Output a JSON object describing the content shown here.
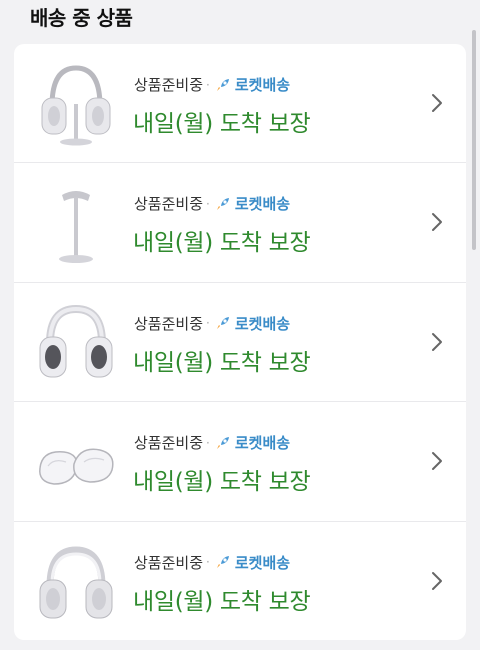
{
  "section": {
    "title": "배송 중 상품"
  },
  "items": [
    {
      "image": "headphone-with-stand",
      "status": "상품준비중",
      "separator": "·",
      "delivery_type": "로켓배송",
      "arrival": "내일(월) 도착 보장"
    },
    {
      "image": "headphone-stand",
      "status": "상품준비중",
      "separator": "·",
      "delivery_type": "로켓배송",
      "arrival": "내일(월) 도착 보장"
    },
    {
      "image": "headphone-with-cover",
      "status": "상품준비중",
      "separator": "·",
      "delivery_type": "로켓배송",
      "arrival": "내일(월) 도착 보장"
    },
    {
      "image": "clear-ear-cup-case",
      "status": "상품준비중",
      "separator": "·",
      "delivery_type": "로켓배송",
      "arrival": "내일(월) 도착 보장"
    },
    {
      "image": "silver-headphones",
      "status": "상품준비중",
      "separator": "·",
      "delivery_type": "로켓배송",
      "arrival": "내일(월) 도착 보장"
    }
  ],
  "colors": {
    "arrival": "#2f8a2e",
    "rocket_label": "#3a8cc8",
    "background": "#f2f2f4"
  }
}
